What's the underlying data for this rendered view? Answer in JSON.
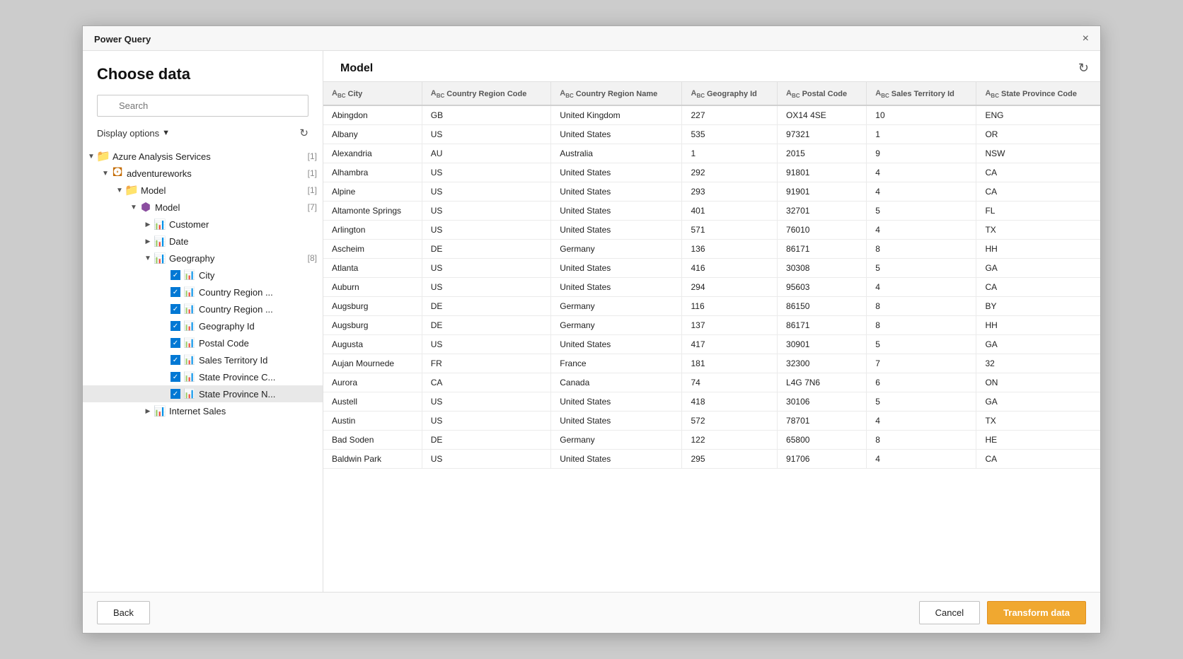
{
  "dialog": {
    "title": "Power Query",
    "close_label": "×"
  },
  "left_panel": {
    "heading": "Choose data",
    "search_placeholder": "Search",
    "display_options_label": "Display options",
    "tree": [
      {
        "id": "azure",
        "indent": 0,
        "toggle": "▲",
        "icon": "folder",
        "label": "Azure Analysis Services",
        "count": "[1]",
        "selected": false
      },
      {
        "id": "adventureworks",
        "indent": 1,
        "toggle": "▲",
        "icon": "db",
        "label": "adventureworks",
        "count": "[1]",
        "selected": false
      },
      {
        "id": "model-outer",
        "indent": 2,
        "toggle": "▲",
        "icon": "folder",
        "label": "Model",
        "count": "[1]",
        "selected": false
      },
      {
        "id": "model-inner",
        "indent": 3,
        "toggle": "▲",
        "icon": "cube",
        "label": "Model",
        "count": "[7]",
        "selected": false
      },
      {
        "id": "customer",
        "indent": 4,
        "toggle": "▶",
        "icon": "table",
        "label": "Customer",
        "count": "",
        "selected": false
      },
      {
        "id": "date",
        "indent": 4,
        "toggle": "▶",
        "icon": "table",
        "label": "Date",
        "count": "",
        "selected": false
      },
      {
        "id": "geography",
        "indent": 4,
        "toggle": "▲",
        "icon": "table",
        "label": "Geography",
        "count": "[8]",
        "selected": false
      },
      {
        "id": "city",
        "indent": 5,
        "toggle": "",
        "icon": "col",
        "label": "City",
        "count": "",
        "checked": true,
        "selected": false
      },
      {
        "id": "country-region-code",
        "indent": 5,
        "toggle": "",
        "icon": "col",
        "label": "Country Region ...",
        "count": "",
        "checked": true,
        "selected": false
      },
      {
        "id": "country-region-name",
        "indent": 5,
        "toggle": "",
        "icon": "col",
        "label": "Country Region ...",
        "count": "",
        "checked": true,
        "selected": false
      },
      {
        "id": "geography-id",
        "indent": 5,
        "toggle": "",
        "icon": "col",
        "label": "Geography Id",
        "count": "",
        "checked": true,
        "selected": false
      },
      {
        "id": "postal-code",
        "indent": 5,
        "toggle": "",
        "icon": "col",
        "label": "Postal Code",
        "count": "",
        "checked": true,
        "selected": false
      },
      {
        "id": "sales-territory-id",
        "indent": 5,
        "toggle": "",
        "icon": "col",
        "label": "Sales Territory Id",
        "count": "",
        "checked": true,
        "selected": false
      },
      {
        "id": "state-province-c",
        "indent": 5,
        "toggle": "",
        "icon": "col",
        "label": "State Province C...",
        "count": "",
        "checked": true,
        "selected": false
      },
      {
        "id": "state-province-n",
        "indent": 5,
        "toggle": "",
        "icon": "col",
        "label": "State Province N...",
        "count": "",
        "checked": true,
        "selected": true
      },
      {
        "id": "internet-sales",
        "indent": 4,
        "toggle": "▶",
        "icon": "table",
        "label": "Internet Sales",
        "count": "",
        "selected": false
      }
    ]
  },
  "right_panel": {
    "title": "Model",
    "columns": [
      {
        "id": "city",
        "label": "City",
        "type": "ABC"
      },
      {
        "id": "country-region-code",
        "label": "Country Region Code",
        "type": "ABC"
      },
      {
        "id": "country-region-name",
        "label": "Country Region Name",
        "type": "ABC"
      },
      {
        "id": "geography-id",
        "label": "Geography Id",
        "type": "ABC"
      },
      {
        "id": "postal-code",
        "label": "Postal Code",
        "type": "ABC"
      },
      {
        "id": "sales-territory-id",
        "label": "Sales Territory Id",
        "type": "ABC"
      },
      {
        "id": "state-province-code",
        "label": "State Province Code",
        "type": "ABC"
      }
    ],
    "rows": [
      [
        "Abingdon",
        "GB",
        "United Kingdom",
        "227",
        "OX14 4SE",
        "10",
        "ENG"
      ],
      [
        "Albany",
        "US",
        "United States",
        "535",
        "97321",
        "1",
        "OR"
      ],
      [
        "Alexandria",
        "AU",
        "Australia",
        "1",
        "2015",
        "9",
        "NSW"
      ],
      [
        "Alhambra",
        "US",
        "United States",
        "292",
        "91801",
        "4",
        "CA"
      ],
      [
        "Alpine",
        "US",
        "United States",
        "293",
        "91901",
        "4",
        "CA"
      ],
      [
        "Altamonte Springs",
        "US",
        "United States",
        "401",
        "32701",
        "5",
        "FL"
      ],
      [
        "Arlington",
        "US",
        "United States",
        "571",
        "76010",
        "4",
        "TX"
      ],
      [
        "Ascheim",
        "DE",
        "Germany",
        "136",
        "86171",
        "8",
        "HH"
      ],
      [
        "Atlanta",
        "US",
        "United States",
        "416",
        "30308",
        "5",
        "GA"
      ],
      [
        "Auburn",
        "US",
        "United States",
        "294",
        "95603",
        "4",
        "CA"
      ],
      [
        "Augsburg",
        "DE",
        "Germany",
        "116",
        "86150",
        "8",
        "BY"
      ],
      [
        "Augsburg",
        "DE",
        "Germany",
        "137",
        "86171",
        "8",
        "HH"
      ],
      [
        "Augusta",
        "US",
        "United States",
        "417",
        "30901",
        "5",
        "GA"
      ],
      [
        "Aujan Mournede",
        "FR",
        "France",
        "181",
        "32300",
        "7",
        "32"
      ],
      [
        "Aurora",
        "CA",
        "Canada",
        "74",
        "L4G 7N6",
        "6",
        "ON"
      ],
      [
        "Austell",
        "US",
        "United States",
        "418",
        "30106",
        "5",
        "GA"
      ],
      [
        "Austin",
        "US",
        "United States",
        "572",
        "78701",
        "4",
        "TX"
      ],
      [
        "Bad Soden",
        "DE",
        "Germany",
        "122",
        "65800",
        "8",
        "HE"
      ],
      [
        "Baldwin Park",
        "US",
        "United States",
        "295",
        "91706",
        "4",
        "CA"
      ]
    ]
  },
  "footer": {
    "back_label": "Back",
    "cancel_label": "Cancel",
    "transform_label": "Transform data"
  }
}
